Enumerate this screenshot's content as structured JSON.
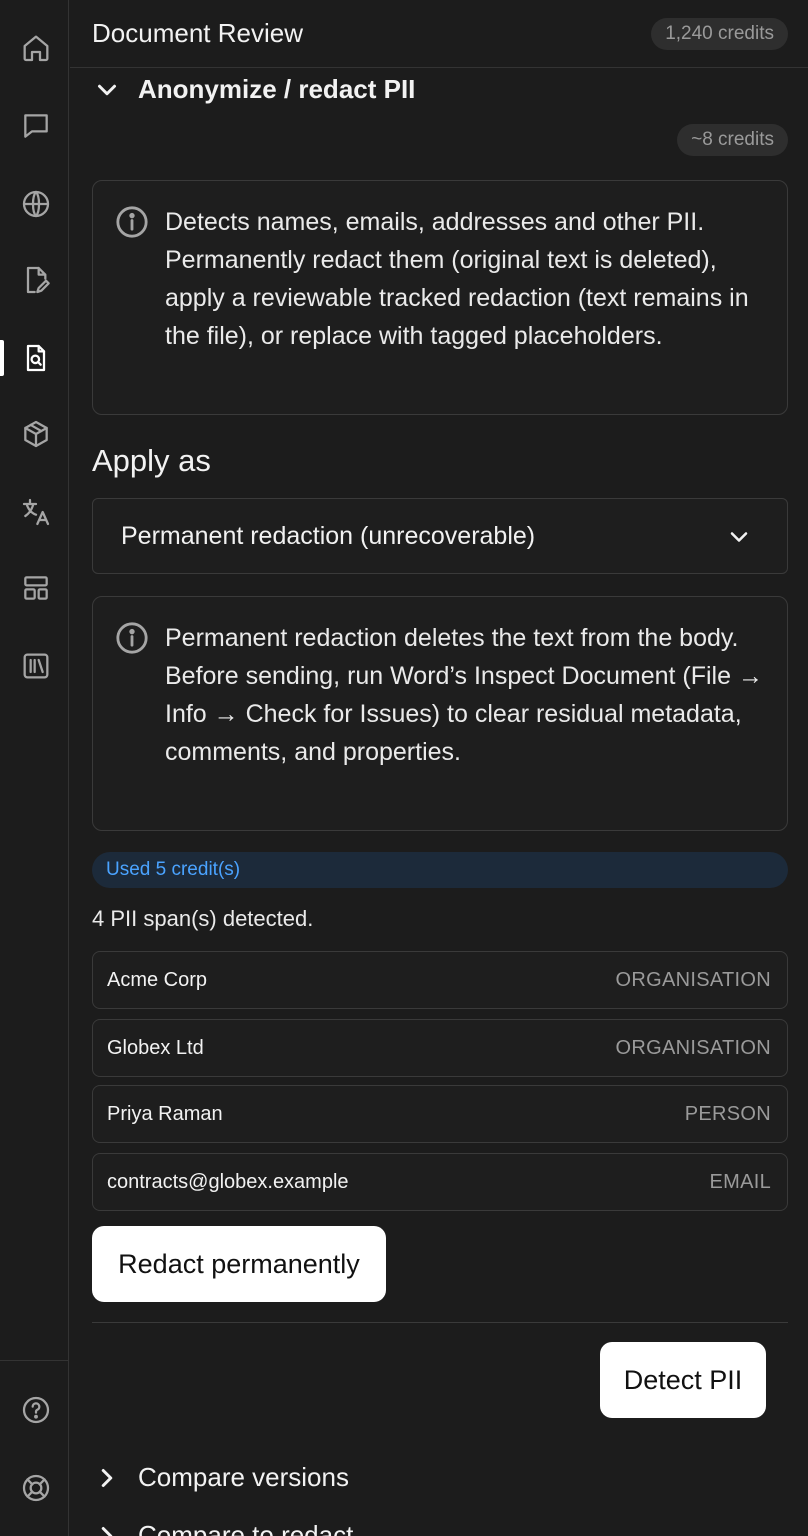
{
  "header": {
    "title": "Document Review",
    "credits": "1,240 credits"
  },
  "sidebar": {
    "items": [
      {
        "icon": "home-icon"
      },
      {
        "icon": "chat-icon"
      },
      {
        "icon": "globe-icon"
      },
      {
        "icon": "document-edit-icon"
      },
      {
        "icon": "document-search-icon",
        "active": true
      },
      {
        "icon": "cube-icon"
      },
      {
        "icon": "translate-icon"
      },
      {
        "icon": "layout-icon"
      },
      {
        "icon": "library-icon"
      }
    ],
    "bottom": [
      {
        "icon": "help-icon"
      },
      {
        "icon": "lifebuoy-icon"
      }
    ]
  },
  "section": {
    "title": "Anonymize / redact PII",
    "cost": "~8 credits",
    "info": "Detects names, emails, addresses and other PII. Permanently redact them (original text is deleted), apply a reviewable tracked redaction (text remains in the file), or replace with tagged placeholders.",
    "apply_label": "Apply as",
    "apply_value": "Permanent redaction (unrecoverable)",
    "warning": "Permanent redaction deletes the text from the body. Before sending, run Word’s Inspect Document (File → Info → Check for Issues) to clear residual metadata, comments, and properties.",
    "used_credits": "Used 5 credit(s)",
    "detected_count": "4 PII span(s) detected.",
    "spans": [
      {
        "text": "Acme Corp",
        "type": "ORGANISATION"
      },
      {
        "text": "Globex Ltd",
        "type": "ORGANISATION"
      },
      {
        "text": "Priya Raman",
        "type": "PERSON"
      },
      {
        "text": "contracts@globex.example",
        "type": "EMAIL"
      }
    ],
    "redact_button": "Redact permanently",
    "detect_button": "Detect PII"
  },
  "collapsed_sections": [
    "Compare versions",
    "Compare to redact"
  ]
}
